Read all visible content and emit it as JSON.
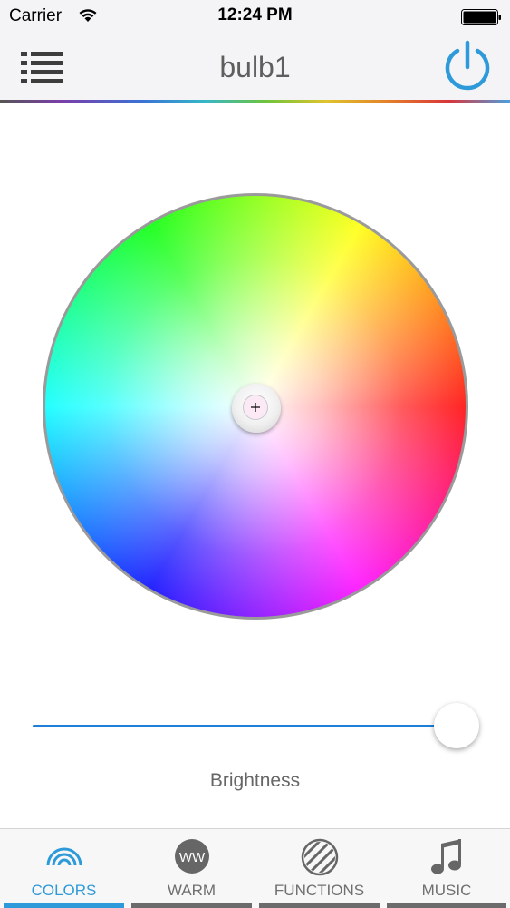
{
  "status_bar": {
    "carrier": "Carrier",
    "time": "12:24 PM",
    "icons": [
      "wifi-icon",
      "battery-icon"
    ]
  },
  "nav_bar": {
    "title": "bulb1",
    "menu_icon": "list-icon",
    "power_icon": "power-icon",
    "power_color": "#2e9ad9"
  },
  "color_wheel": {
    "selected_color": "#fbe9f6"
  },
  "brightness": {
    "label": "Brightness",
    "value_fraction": 1.0,
    "track_color": "#1e7fd8"
  },
  "tabs": [
    {
      "label": "COLORS",
      "icon": "rainbow-icon",
      "active": true
    },
    {
      "label": "WARM",
      "icon": "ww-icon",
      "badge": "WW",
      "active": false
    },
    {
      "label": "FUNCTIONS",
      "icon": "striped-circle-icon",
      "active": false
    },
    {
      "label": "MUSIC",
      "icon": "music-note-icon",
      "active": false
    }
  ],
  "colors": {
    "accent": "#2e9ad9",
    "inactive": "#6b6b6b"
  }
}
